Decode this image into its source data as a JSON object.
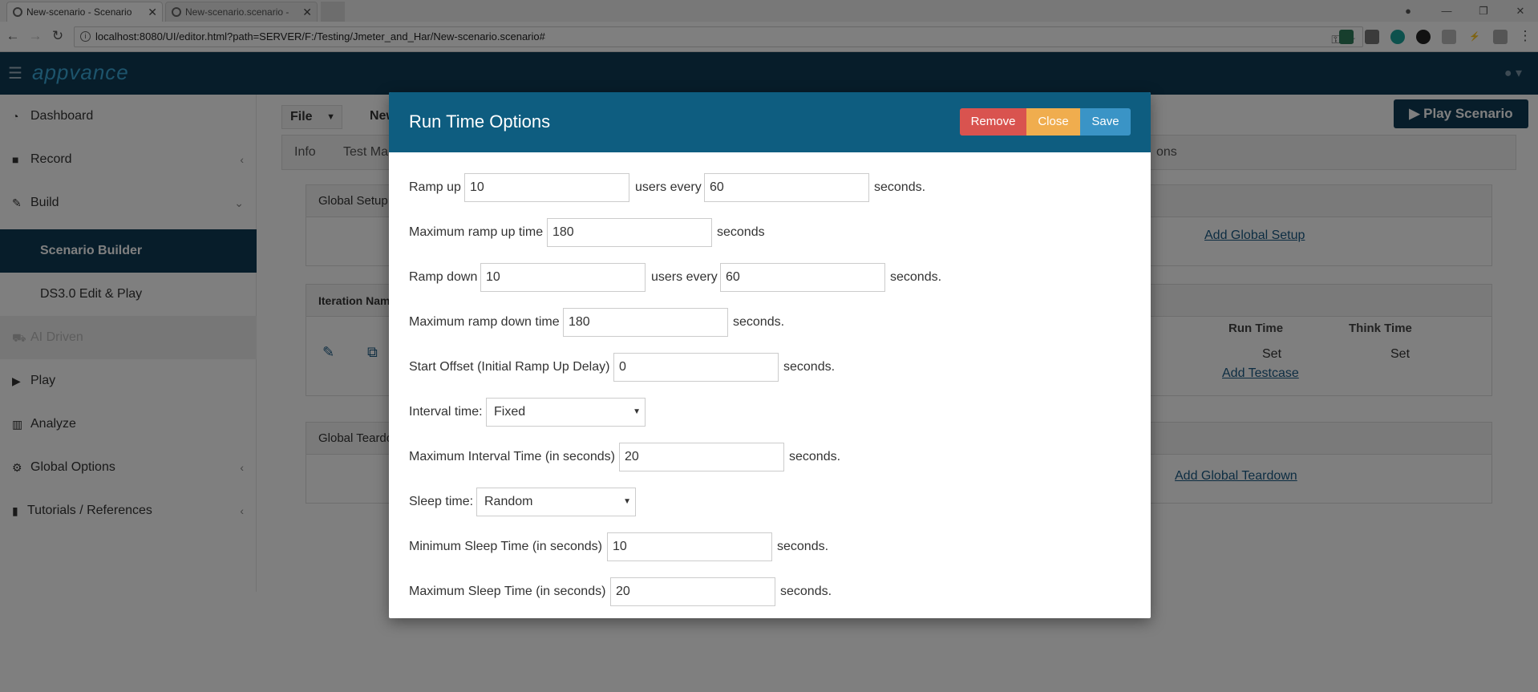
{
  "browser": {
    "tabs": [
      {
        "title": "New-scenario - Scenario"
      },
      {
        "title": "New-scenario.scenario -"
      }
    ],
    "url": "localhost:8080/UI/editor.html?path=SERVER/F:/Testing/Jmeter_and_Har/New-scenario.scenario#",
    "info_icon": "i"
  },
  "app": {
    "logo": "appvance"
  },
  "sidebar": {
    "items": [
      {
        "label": "Dashboard",
        "icon": "dashboard-icon"
      },
      {
        "label": "Record",
        "icon": "video-camera-icon"
      },
      {
        "label": "Build",
        "icon": "wrench-icon"
      },
      {
        "label": "Scenario Builder"
      },
      {
        "label": "DS3.0 Edit & Play"
      },
      {
        "label": "AI Driven",
        "icon": "cars-icon"
      },
      {
        "label": "Play",
        "icon": "play-icon"
      },
      {
        "label": "Analyze",
        "icon": "bar-chart-icon"
      },
      {
        "label": "Global Options",
        "icon": "gears-icon"
      },
      {
        "label": "Tutorials / References",
        "icon": "book-icon"
      }
    ]
  },
  "main": {
    "file_label": "File",
    "scenario_name": "New",
    "play_button": "Play Scenario",
    "tabs": [
      "Info",
      "Test Ma",
      "ons"
    ],
    "global_setup": {
      "title": "Global Setup",
      "link": "Add Global Setup"
    },
    "iteration": {
      "header": "Iteration Name",
      "columns": [
        "Run Time",
        "Think Time"
      ],
      "row": [
        "Set",
        "Set"
      ],
      "link": "Add Testcase"
    },
    "global_teardown": {
      "title": "Global Teardo",
      "link": "Add Global Teardown"
    }
  },
  "modal": {
    "title": "Run Time Options",
    "buttons": {
      "remove": "Remove",
      "close": "Close",
      "save": "Save"
    },
    "rows": {
      "ramp_up": {
        "label": "Ramp up",
        "users": "10",
        "mid": "users every",
        "interval": "60",
        "suffix": "seconds."
      },
      "max_ramp_up": {
        "label": "Maximum ramp up time",
        "value": "180",
        "suffix": "seconds"
      },
      "ramp_down": {
        "label": "Ramp down",
        "users": "10",
        "mid": "users every",
        "interval": "60",
        "suffix": "seconds."
      },
      "max_ramp_down": {
        "label": "Maximum ramp down time",
        "value": "180",
        "suffix": "seconds."
      },
      "start_offset": {
        "label": "Start Offset (Initial Ramp Up Delay)",
        "value": "0",
        "suffix": "seconds."
      },
      "interval_time": {
        "label": "Interval time:",
        "value": "Fixed"
      },
      "max_interval": {
        "label": "Maximum Interval Time (in seconds)",
        "value": "20",
        "suffix": "seconds."
      },
      "sleep_time": {
        "label": "Sleep time:",
        "value": "Random"
      },
      "min_sleep": {
        "label": "Minimum Sleep Time (in seconds)",
        "value": "10",
        "suffix": "seconds."
      },
      "max_sleep": {
        "label": "Maximum Sleep Time (in seconds)",
        "value": "20",
        "suffix": "seconds."
      }
    }
  }
}
